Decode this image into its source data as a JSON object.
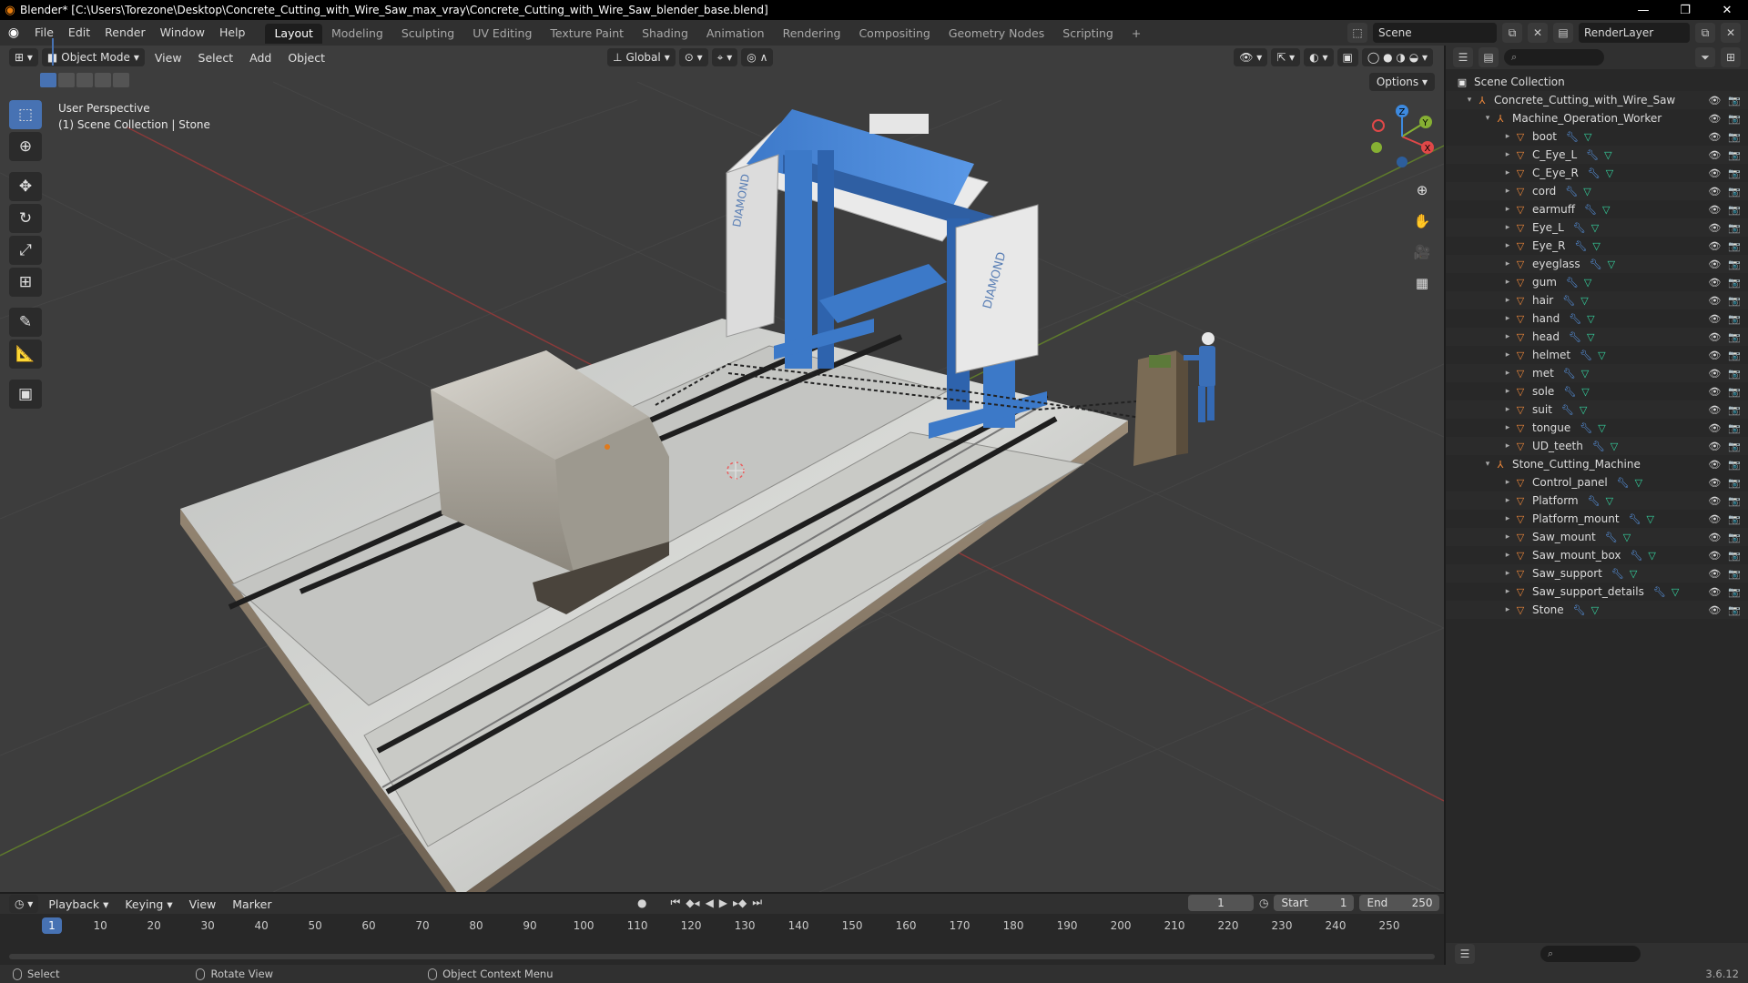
{
  "window": {
    "title": "Blender* [C:\\Users\\Torezone\\Desktop\\Concrete_Cutting_with_Wire_Saw_max_vray\\Concrete_Cutting_with_Wire_Saw_blender_base.blend]"
  },
  "menu": [
    "File",
    "Edit",
    "Render",
    "Window",
    "Help"
  ],
  "workspaces": [
    {
      "label": "Layout",
      "active": true
    },
    {
      "label": "Modeling"
    },
    {
      "label": "Sculpting"
    },
    {
      "label": "UV Editing"
    },
    {
      "label": "Texture Paint"
    },
    {
      "label": "Shading"
    },
    {
      "label": "Animation"
    },
    {
      "label": "Rendering"
    },
    {
      "label": "Compositing"
    },
    {
      "label": "Geometry Nodes"
    },
    {
      "label": "Scripting"
    }
  ],
  "scene": {
    "name": "Scene",
    "view_layer": "RenderLayer"
  },
  "viewport": {
    "mode": "Object Mode",
    "menus": [
      "View",
      "Select",
      "Add",
      "Object"
    ],
    "transform_orientation": "Global",
    "options_label": "Options",
    "info_line1": "User Perspective",
    "info_line2": "(1) Scene Collection | Stone"
  },
  "outliner": {
    "root": "Scene Collection",
    "collection": "Concrete_Cutting_with_Wire_Saw",
    "groups": [
      {
        "name": "Machine_Operation_Worker",
        "children": [
          "boot",
          "C_Eye_L",
          "C_Eye_R",
          "cord",
          "earmuff",
          "Eye_L",
          "Eye_R",
          "eyeglass",
          "gum",
          "hair",
          "hand",
          "head",
          "helmet",
          "met",
          "sole",
          "suit",
          "tongue",
          "UD_teeth"
        ]
      },
      {
        "name": "Stone_Cutting_Machine",
        "children": [
          "Control_panel",
          "Platform",
          "Platform_mount",
          "Saw_mount",
          "Saw_mount_box",
          "Saw_support",
          "Saw_support_details",
          "Stone"
        ]
      }
    ]
  },
  "timeline": {
    "menus": [
      "Playback",
      "Keying",
      "View",
      "Marker"
    ],
    "current_frame": "1",
    "start_label": "Start",
    "start": "1",
    "end_label": "End",
    "end": "250",
    "ticks": [
      "10",
      "20",
      "30",
      "40",
      "50",
      "60",
      "70",
      "80",
      "90",
      "100",
      "110",
      "120",
      "130",
      "140",
      "150",
      "160",
      "170",
      "180",
      "190",
      "200",
      "210",
      "220",
      "230",
      "240",
      "250"
    ]
  },
  "statusbar": {
    "select": "Select",
    "rotate": "Rotate View",
    "context": "Object Context Menu",
    "version": "3.6.12"
  },
  "colors": {
    "accent": "#4772b3",
    "axis_x": "#e04848",
    "axis_y": "#86b033",
    "axis_z": "#3d8ae0",
    "mesh_icon": "#f0883a"
  }
}
